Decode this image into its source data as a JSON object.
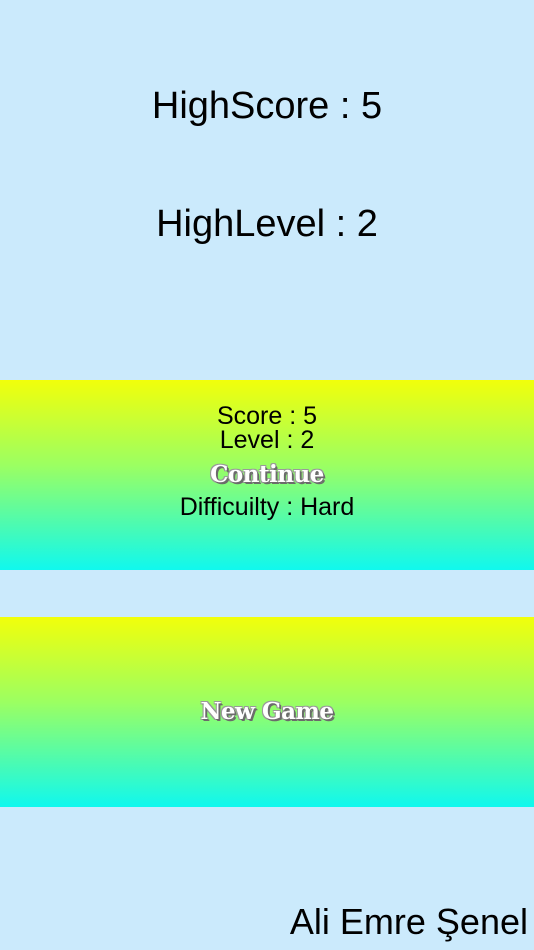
{
  "stats": {
    "high_score": "HighScore : 5",
    "high_level": "HighLevel : 2"
  },
  "continue_panel": {
    "score": "Score : 5",
    "level": "Level : 2",
    "button_label": "Continue",
    "difficulty": "Difficuilty : Hard"
  },
  "new_game": {
    "button_label": "New Game"
  },
  "footer": {
    "author": "Ali Emre Şenel"
  },
  "colors": {
    "background": "#cbeafc",
    "gradient_top": "#f2ff0a",
    "gradient_bottom": "#10f8ee"
  }
}
